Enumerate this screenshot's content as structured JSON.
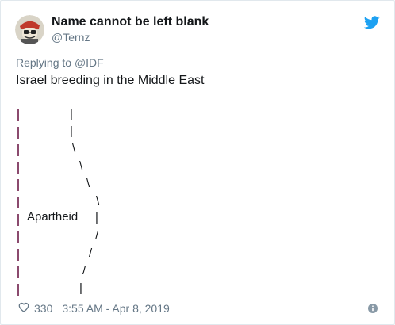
{
  "tweet": {
    "display_name": "Name cannot be left blank",
    "handle": "@Ternz",
    "replying_prefix": "Replying to",
    "replying_mention": "@IDF",
    "text": "Israel breeding in the Middle East",
    "meme": {
      "label": "Apartheid",
      "right_column": [
        "|",
        "|",
        "\\",
        "\\",
        "\\",
        "\\",
        "|",
        "/",
        "/",
        "/",
        "|"
      ]
    },
    "like_count": "330",
    "timestamp": "3:55 AM - Apr 8, 2019"
  },
  "colors": {
    "accent": "#1da1f2",
    "wall": "#8b4a6e",
    "muted": "#657786",
    "text": "#14171a"
  },
  "icons": {
    "brand": "twitter-bird-icon",
    "like": "heart-icon",
    "info": "info-icon"
  }
}
